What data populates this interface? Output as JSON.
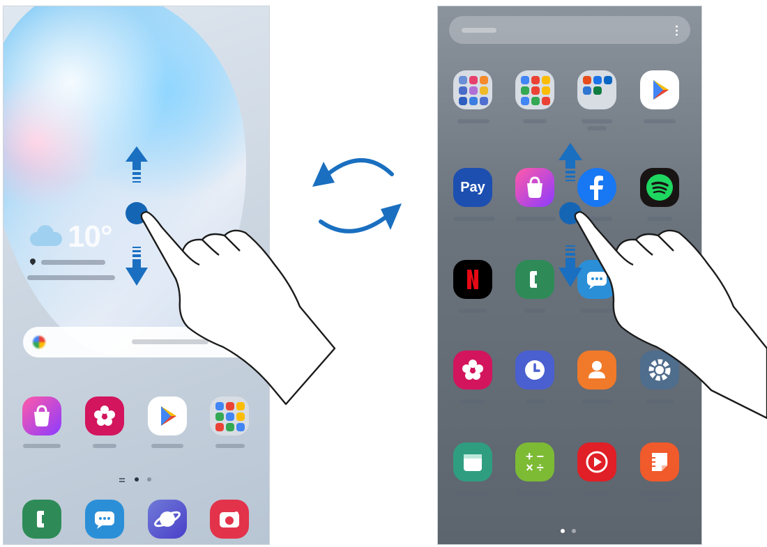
{
  "left_screen": {
    "weather": {
      "temperature": "10°"
    }
  },
  "right_screen": {},
  "colors": {
    "accent": "#1565b5",
    "arrow_blue": "#1a6fc0"
  },
  "icons": {
    "left_apps": [
      "galaxy-store-icon",
      "gallery-icon",
      "play-store-icon",
      "google-folder-icon"
    ],
    "left_dock": [
      "phone-icon",
      "messages-icon",
      "internet-icon",
      "camera-icon"
    ],
    "right_apps": [
      "samsung-folder-icon",
      "google-folder-icon",
      "microsoft-folder-icon",
      "play-store-icon",
      "samsung-pay-icon",
      "galaxy-store-icon",
      "facebook-icon",
      "spotify-icon",
      "netflix-icon",
      "phone-icon",
      "messages-icon",
      "gallery-icon",
      "clock-icon",
      "contacts-icon",
      "settings-icon",
      "calendar-icon",
      "calculator-icon",
      "youtube-music-icon",
      "samsung-notes-icon"
    ],
    "gestures": [
      "swipe-up-arrow-icon",
      "swipe-down-arrow-icon",
      "switch-arrows-icon",
      "hand-icon"
    ]
  },
  "labels": {
    "pay": "Pay"
  }
}
